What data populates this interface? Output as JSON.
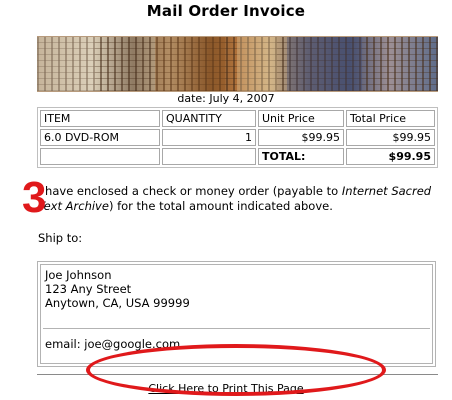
{
  "header": {
    "title": "Mail Order Invoice"
  },
  "invoice": {
    "date_text": "date: July 4, 2007",
    "columns": [
      "ITEM",
      "QUANTITY",
      "Unit Price",
      "Total Price"
    ],
    "rows": [
      {
        "item": "6.0 DVD-ROM",
        "quantity": "1",
        "unit_price": "$99.95",
        "total_price": "$99.95"
      }
    ],
    "total_label": "TOTAL:",
    "total_value": "$99.95"
  },
  "payment": {
    "text_before": "I have enclosed a check or money order (payable to ",
    "payee": "Internet Sacred Text Archive",
    "text_after": ") for the total amount indicated above."
  },
  "shipping": {
    "label": "Ship to:",
    "name": "Joe Johnson",
    "street": "123 Any Street",
    "city_line": "Anytown, CA, USA 99999",
    "email": "email: joe@google.com"
  },
  "actions": {
    "print_link": "Click Here to Print This Page"
  },
  "annotation": {
    "step_number": "3",
    "color": "#e0191b"
  },
  "banner": {
    "description_icon": "manuscript-collage-banner"
  }
}
